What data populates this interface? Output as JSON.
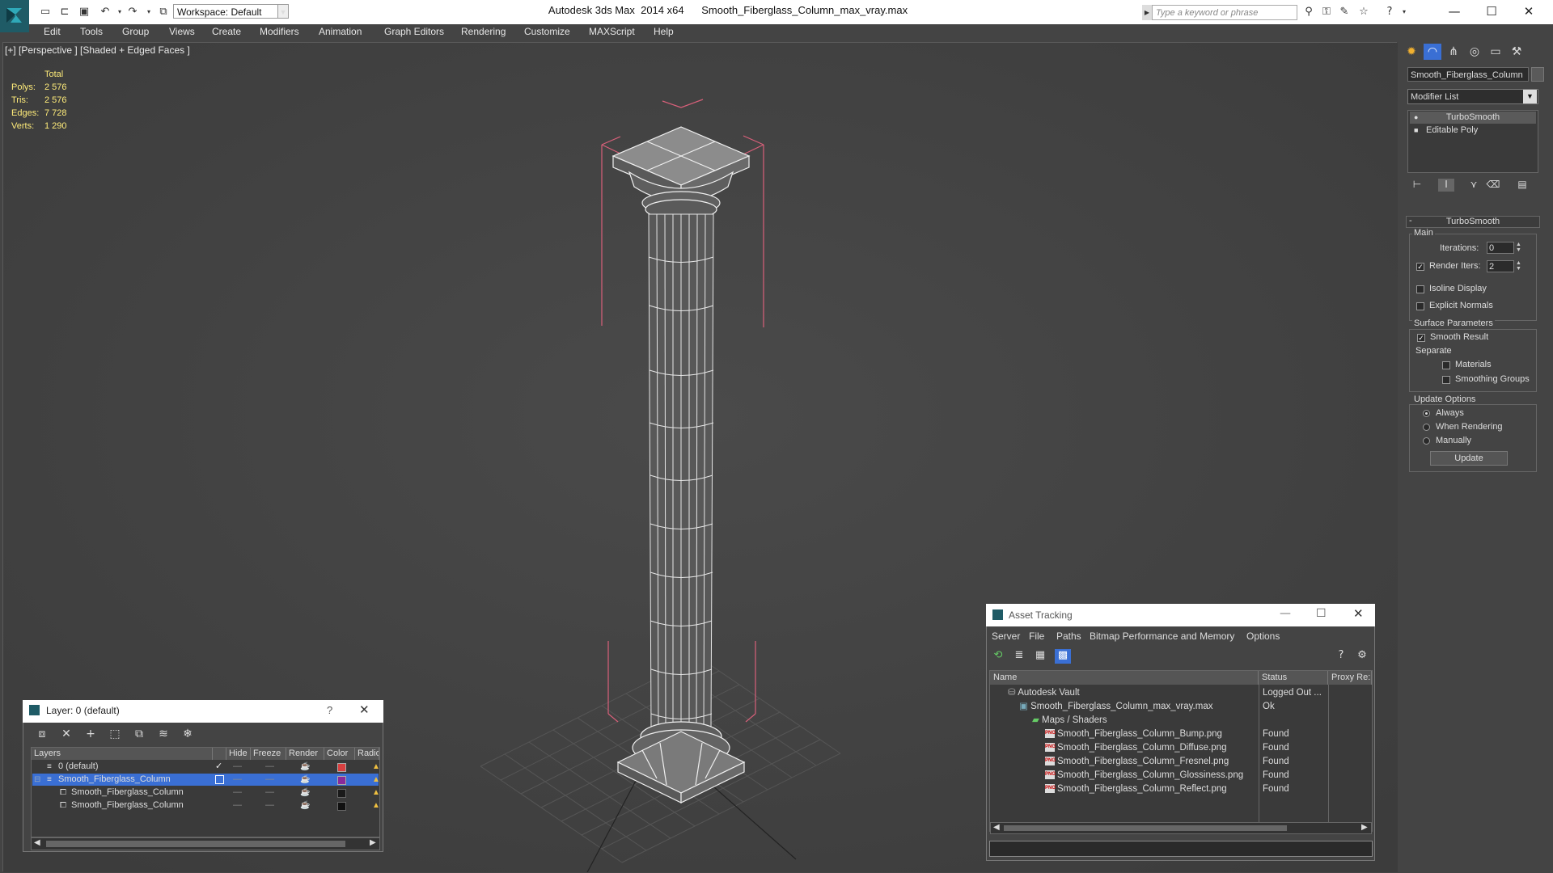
{
  "titlebar": {
    "workspace_label": "Workspace: Default",
    "app_title": "Autodesk 3ds Max  2014 x64",
    "file_name": "Smooth_Fiberglass_Column_max_vray.max",
    "search_placeholder": "Type a keyword or phrase"
  },
  "menu": [
    "Edit",
    "Tools",
    "Group",
    "Views",
    "Create",
    "Modifiers",
    "Animation",
    "Graph Editors",
    "Rendering",
    "Customize",
    "MAXScript",
    "Help"
  ],
  "viewport": {
    "label": "[+] [Perspective ] [Shaded + Edged Faces ]",
    "stats": {
      "header": "Total",
      "polys_label": "Polys:",
      "polys": "2 576",
      "tris_label": "Tris:",
      "tris": "2 576",
      "edges_label": "Edges:",
      "edges": "7 728",
      "verts_label": "Verts:",
      "verts": "1 290"
    }
  },
  "command_panel": {
    "object_name": "Smooth_Fiberglass_Column",
    "modifier_list": "Modifier List",
    "stack": [
      "TurboSmooth",
      "Editable Poly"
    ],
    "rollout_title": "TurboSmooth",
    "main_group": "Main",
    "iterations_label": "Iterations:",
    "iterations": "0",
    "render_iters_label": "Render Iters:",
    "render_iters": "2",
    "render_iters_checked": true,
    "isoline_label": "Isoline Display",
    "explicit_normals_label": "Explicit Normals",
    "surface_group": "Surface Parameters",
    "smooth_result_label": "Smooth Result",
    "smooth_result_checked": true,
    "separate_label": "Separate",
    "materials_label": "Materials",
    "smoothing_groups_label": "Smoothing Groups",
    "update_group": "Update Options",
    "always_label": "Always",
    "when_rendering_label": "When Rendering",
    "manually_label": "Manually",
    "update_button": "Update"
  },
  "layer_dialog": {
    "title": "Layer: 0 (default)",
    "help": "?",
    "columns": [
      "Layers",
      "Hide",
      "Freeze",
      "Render",
      "Color",
      "Radio"
    ],
    "rows": [
      {
        "name": "0 (default)",
        "color": "#d94040"
      },
      {
        "name": "Smooth_Fiberglass_Column",
        "color": "#8a2a9a"
      },
      {
        "name": "Smooth_Fiberglass_Column",
        "color": "#1a1a1a"
      },
      {
        "name": "Smooth_Fiberglass_Column",
        "color": "#111111"
      }
    ]
  },
  "asset_tracking": {
    "title": "Asset Tracking",
    "menu": [
      "Server",
      "File",
      "Paths",
      "Bitmap Performance and Memory",
      "Options"
    ],
    "columns": [
      "Name",
      "Status",
      "Proxy Re:"
    ],
    "rows": [
      {
        "name": "Autodesk Vault",
        "status": "Logged Out ..."
      },
      {
        "name": "Smooth_Fiberglass_Column_max_vray.max",
        "status": "Ok"
      },
      {
        "name": "Maps / Shaders",
        "status": ""
      },
      {
        "name": "Smooth_Fiberglass_Column_Bump.png",
        "status": "Found"
      },
      {
        "name": "Smooth_Fiberglass_Column_Diffuse.png",
        "status": "Found"
      },
      {
        "name": "Smooth_Fiberglass_Column_Fresnel.png",
        "status": "Found"
      },
      {
        "name": "Smooth_Fiberglass_Column_Glossiness.png",
        "status": "Found"
      },
      {
        "name": "Smooth_Fiberglass_Column_Reflect.png",
        "status": "Found"
      }
    ]
  },
  "colors": {
    "viewport_bg": "#454545",
    "selection": "#3a6fd4",
    "stats_text": "#ffec7a",
    "bbox": "#d9607a"
  }
}
